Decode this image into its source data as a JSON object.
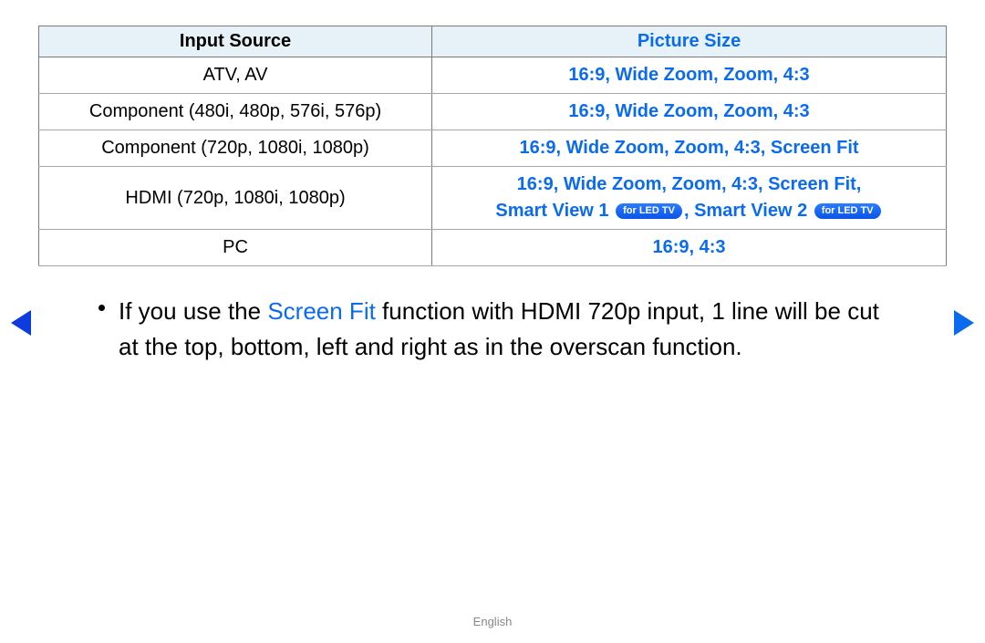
{
  "table": {
    "headers": {
      "left": "Input Source",
      "right": "Picture Size"
    },
    "rows": [
      {
        "source": "ATV, AV",
        "picture": "16:9, Wide Zoom, Zoom, 4:3"
      },
      {
        "source": "Component (480i, 480p, 576i, 576p)",
        "picture": "16:9, Wide Zoom, Zoom, 4:3"
      },
      {
        "source": "Component (720p, 1080i, 1080p)",
        "picture": "16:9, Wide Zoom, Zoom, 4:3, Screen Fit"
      },
      {
        "source": "HDMI (720p, 1080i, 1080p)",
        "picture_line1": "16:9, Wide Zoom, Zoom, 4:3, Screen Fit,",
        "smart1": "Smart View 1",
        "badge1": "for LED TV",
        "sep": ", ",
        "smart2": "Smart View 2",
        "badge2": "for LED TV"
      },
      {
        "source": "PC",
        "picture": "16:9, 4:3"
      }
    ]
  },
  "bullet": {
    "pre": "If you use the ",
    "highlight": "Screen Fit",
    "post": " function with HDMI 720p input, 1 line will be cut at the top, bottom, left and right as in the overscan function."
  },
  "footer": "English"
}
